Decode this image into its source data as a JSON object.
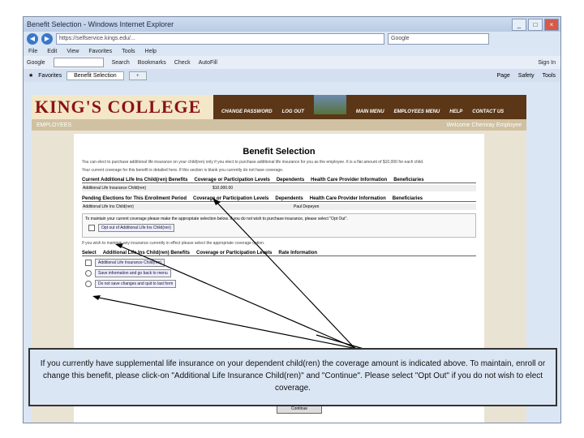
{
  "window": {
    "title": "Benefit Selection - Windows Internet Explorer",
    "address_url": "https://selfservice.kings.edu/...",
    "search_placeholder": "Google"
  },
  "menu_bar": [
    "File",
    "Edit",
    "View",
    "Favorites",
    "Tools",
    "Help"
  ],
  "google_bar": {
    "label": "Google",
    "search": "Search",
    "bookmarks": "Bookmarks",
    "check": "Check",
    "autofill": "AutoFill",
    "signin": "Sign In"
  },
  "tabs": {
    "favorites": "Favorites",
    "active": "Benefit Selection",
    "tools": [
      "Page",
      "Safety",
      "Tools"
    ]
  },
  "site": {
    "logo": "KING'S COLLEGE",
    "nav": [
      "CHANGE PASSWORD",
      "LOG OUT",
      "MAIN MENU",
      "EMPLOYEES MENU",
      "HELP",
      "CONTACT US"
    ],
    "section": "EMPLOYEES",
    "user": "Welcome Chemray Employee"
  },
  "page": {
    "title": "Benefit Selection",
    "intro": "You can elect to purchase additional life insurance on your child(ren) only if you elect to purchase additional life insurance for you as the employee. It is a flat amount of $10,000 for each child.",
    "current_note": "Your current coverage for this benefit is detailed here. If this section is blank you currently do not have coverage.",
    "current_headers": [
      "Current Additional Life Ins Child(ren) Benefits",
      "Coverage or Participation Levels",
      "Dependents",
      "Health Care Provider Information",
      "Beneficiaries"
    ],
    "current_row": [
      "Additional Life Insurance Child(ren)",
      "$10,000.00"
    ],
    "pending_headers": [
      "Pending Elections for This Enrollment Period",
      "Coverage or Participation Levels",
      "Dependents",
      "Health Care Provider Information",
      "Beneficiaries"
    ],
    "pending_row": [
      "Additional Life Ins Child(ren)",
      "Paul Depeyen"
    ],
    "optout_note": "To maintain your current coverage please make the appropriate selection below. If you do not wish to purchase insurance, please select \"Opt Out\".",
    "optout_label": "Opt out of Additional Life Ins Child(ren)",
    "maintain_note": "If you wish to maintain any insurance currently in effect please select the appropriate coverage option.",
    "select_headers": [
      "Select",
      "Additional Life Ins Child(ren) Benefits",
      "Coverage or Participation Levels",
      "Rate Information"
    ],
    "options": [
      "Additional Life Insurance Child(ren)",
      "Save information and go back to menu",
      "Do not save changes and quit to last form"
    ],
    "continue": "Continue"
  },
  "callout": {
    "text": "If you currently have supplemental life insurance on your dependent child(ren) the coverage amount is indicated above. To maintain, enroll or change this benefit, please click-on \"Additional Life Insurance Child(ren)\" and \"Continue\". Please select \"Opt Out\" if you do not wish to elect coverage."
  }
}
